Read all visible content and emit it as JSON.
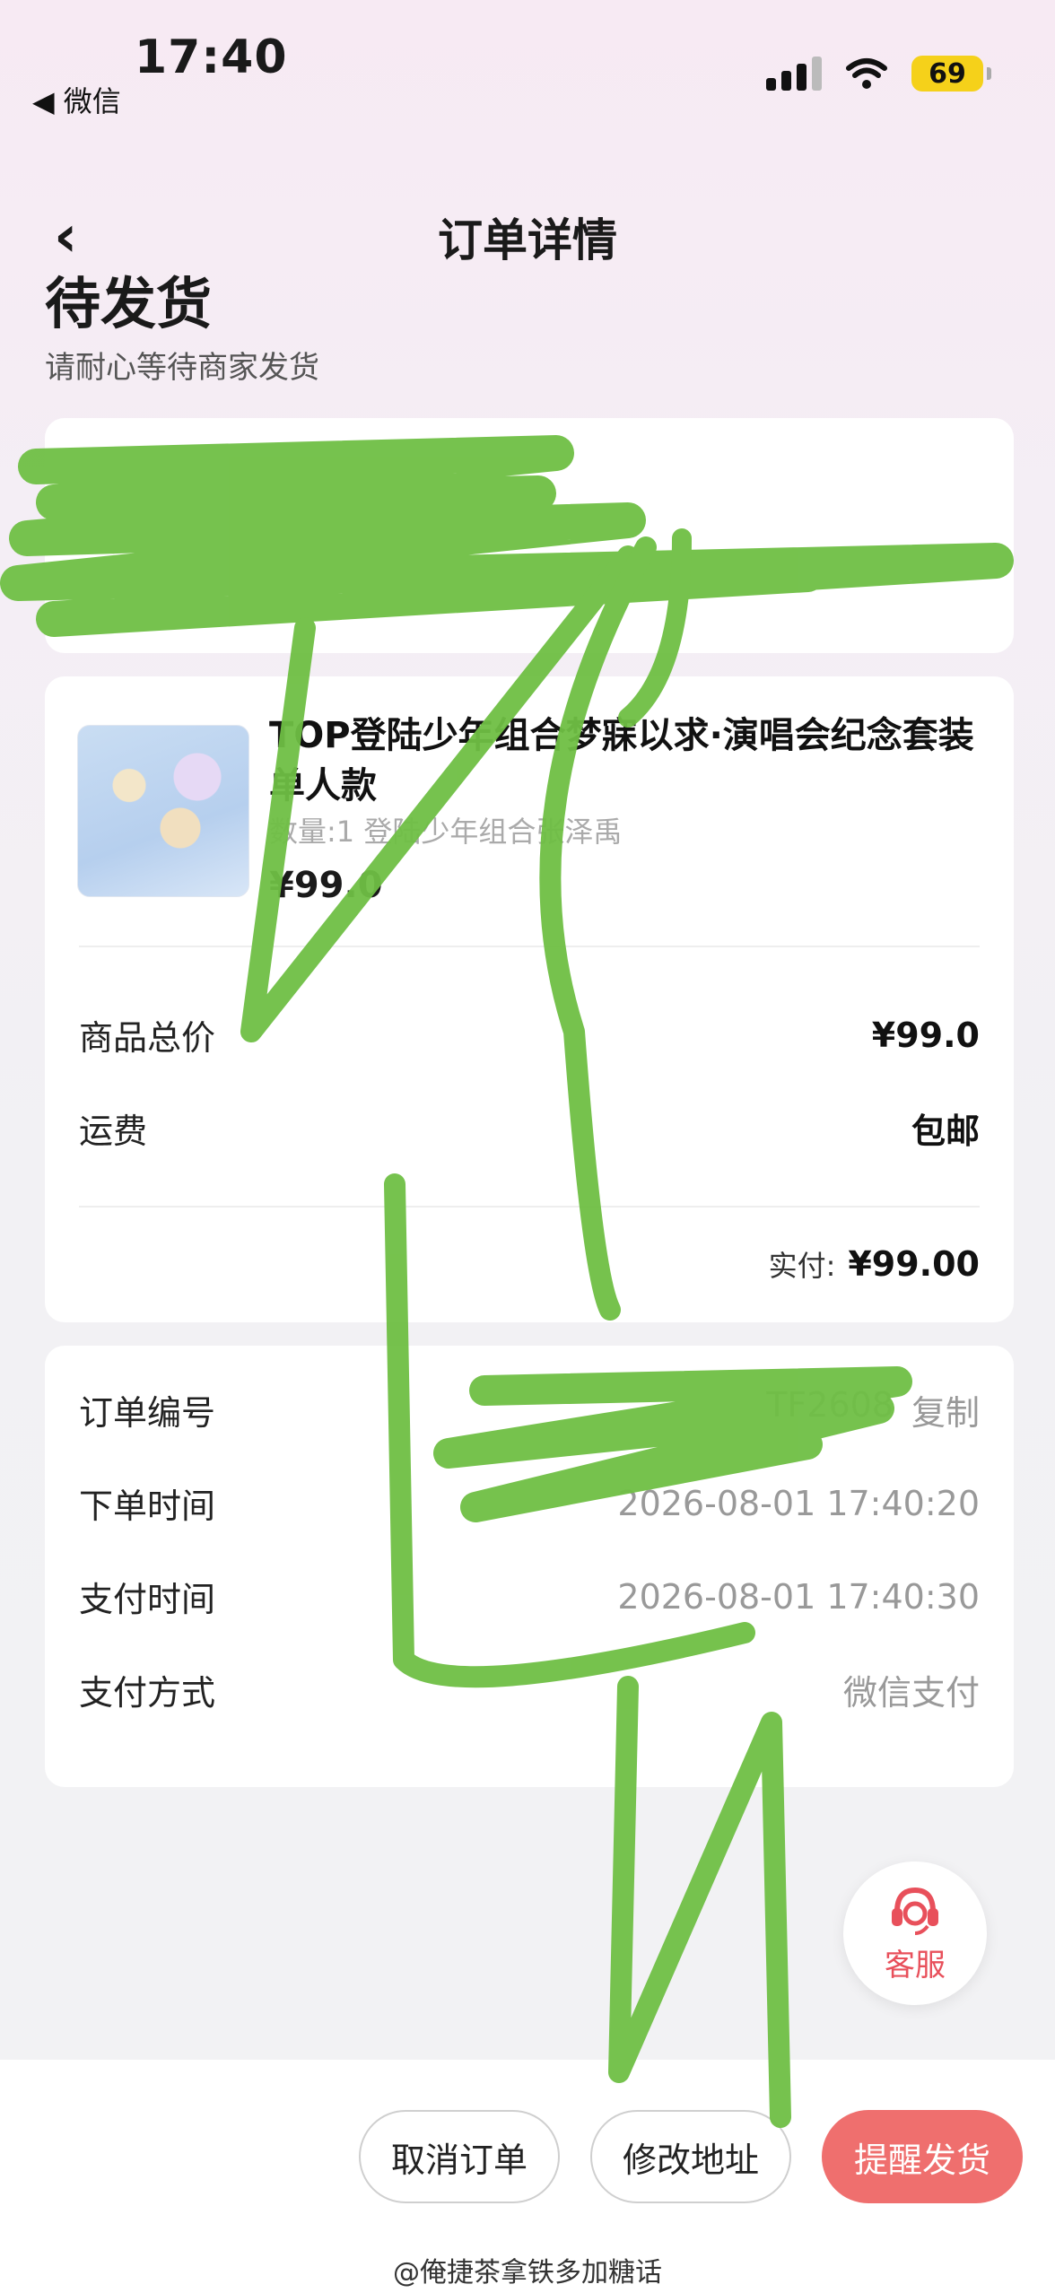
{
  "status_bar": {
    "time": "17:40",
    "back_app": "◀ 微信",
    "battery": "69"
  },
  "header": {
    "title": "订单详情",
    "back_icon": "‹"
  },
  "order_status": {
    "title": "待发货",
    "subtitle": "请耐心等待商家发货"
  },
  "product": {
    "name": "TOP登陆少年组合梦寐以求·演唱会纪念套装单人款",
    "spec": "数量:1 登陆少年组合张泽禹",
    "price": "¥99.0"
  },
  "price_summary": {
    "goods_total_label": "商品总价",
    "goods_total_value": "¥99.0",
    "shipping_label": "运费",
    "shipping_value": "包邮",
    "paid_label": "实付:",
    "paid_value": "¥99.00"
  },
  "order_info": {
    "order_no_label": "订单编号",
    "order_no_value": "TF2608",
    "copy_label": "复制",
    "order_time_label": "下单时间",
    "order_time_value": "2026-08-01 17:40:20",
    "pay_time_label": "支付时间",
    "pay_time_value": "2026-08-01 17:40:30",
    "pay_method_label": "支付方式",
    "pay_method_value": "微信支付"
  },
  "customer_service": {
    "label": "客服"
  },
  "actions": {
    "cancel": "取消订单",
    "modify_address": "修改地址",
    "remind": "提醒发货"
  },
  "watermark": "@俺捷茶拿铁多加糖话"
}
